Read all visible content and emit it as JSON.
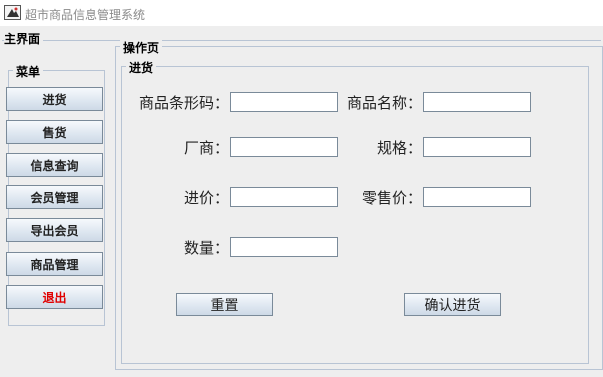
{
  "window": {
    "title": "超市商品信息管理系统",
    "icon": "app-window-icon"
  },
  "main_panel": {
    "label": "主界面"
  },
  "menu": {
    "label": "菜单",
    "items": [
      {
        "label": "进货"
      },
      {
        "label": "售货"
      },
      {
        "label": "信息查询"
      },
      {
        "label": "会员管理"
      },
      {
        "label": "导出会员"
      },
      {
        "label": "商品管理"
      },
      {
        "label": "退出",
        "color": "#e00000"
      }
    ]
  },
  "operation": {
    "label": "操作页",
    "purchase": {
      "label": "进货",
      "fields": {
        "barcode": {
          "label": "商品条形码：",
          "value": ""
        },
        "name": {
          "label": "商品名称：",
          "value": ""
        },
        "maker": {
          "label": "厂商：",
          "value": ""
        },
        "spec": {
          "label": "规格：",
          "value": ""
        },
        "cost": {
          "label": "进价：",
          "value": ""
        },
        "retail": {
          "label": "零售价：",
          "value": ""
        },
        "quantity": {
          "label": "数量：",
          "value": ""
        }
      },
      "reset_label": "重置",
      "confirm_label": "确认进货"
    }
  }
}
